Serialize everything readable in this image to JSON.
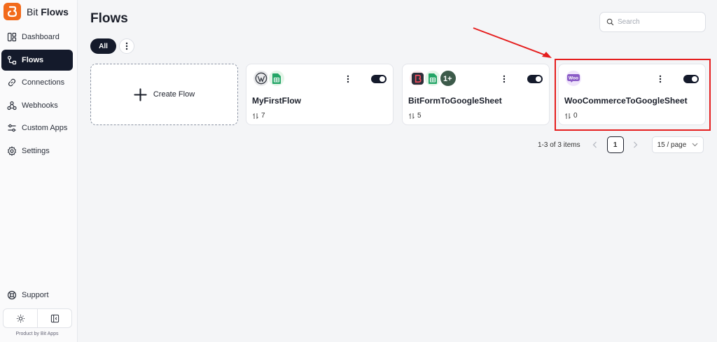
{
  "brand": {
    "name_prefix": "Bit",
    "name_bold": "Flows"
  },
  "sidebar": {
    "items": [
      {
        "label": "Dashboard",
        "icon": "dashboard-icon",
        "active": false
      },
      {
        "label": "Flows",
        "icon": "flows-icon",
        "active": true
      },
      {
        "label": "Connections",
        "icon": "link-icon",
        "active": false
      },
      {
        "label": "Webhooks",
        "icon": "webhook-icon",
        "active": false
      },
      {
        "label": "Custom Apps",
        "icon": "sliders-icon",
        "active": false
      },
      {
        "label": "Settings",
        "icon": "gear-icon",
        "active": false
      }
    ],
    "support_label": "Support",
    "footer": "Product by Bit Apps"
  },
  "main": {
    "title": "Flows",
    "search": {
      "placeholder": "Search",
      "value": ""
    },
    "filter": {
      "all_label": "All"
    },
    "create_label": "Create Flow",
    "flows": [
      {
        "name": "MyFirstFlow",
        "count": "7",
        "apps": [
          "wordpress-icon",
          "google-sheets-icon"
        ],
        "enabled": true
      },
      {
        "name": "BitFormToGoogleSheet",
        "count": "5",
        "apps": [
          "bit-form-icon",
          "google-sheets-icon",
          "plus-one-icon"
        ],
        "enabled": true
      },
      {
        "name": "WooCommerceToGoogleSheet",
        "count": "0",
        "apps": [
          "woocommerce-icon"
        ],
        "enabled": true
      }
    ]
  },
  "pagination": {
    "range": "1-3 of 3 items",
    "current_page": "1",
    "page_size": "15 / page"
  },
  "colors": {
    "accent_dark": "#141a2b",
    "brand_orange": "#f26a1b",
    "highlight_red": "#e51e1e"
  }
}
